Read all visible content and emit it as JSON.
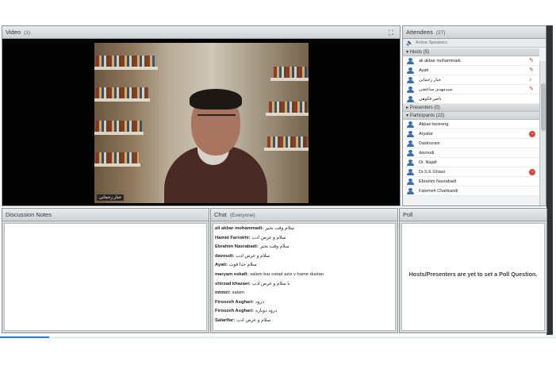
{
  "video_pod": {
    "title": "Video",
    "count": "(1)",
    "name_tag": "جبار رحمانی",
    "fullscreen_icon": "fullscreen-icon"
  },
  "attendees_pod": {
    "title": "Attendees",
    "count": "(27)",
    "active_speakers": "Active Speakers",
    "sections": {
      "hosts": "Hosts (5)",
      "presenters": "Presenters (0)",
      "participants": "Participants (22)"
    },
    "hosts": [
      {
        "name": "ali akbar mohammadi",
        "status": "pencil"
      },
      {
        "name": "Ayati",
        "status": "pencil"
      },
      {
        "name": "جبار رحمانی",
        "status": "mic"
      },
      {
        "name": "سیدمهدی ساعتچی",
        "status": "pencil"
      },
      {
        "name": "ناصر فکوهی",
        "status": ""
      }
    ],
    "participants": [
      {
        "name": "Akbari booreng",
        "status": ""
      },
      {
        "name": "Aryafar",
        "status": "raised"
      },
      {
        "name": "Dastourani",
        "status": ""
      },
      {
        "name": "davoudi",
        "status": ""
      },
      {
        "name": "Dr. Najafi",
        "status": ""
      },
      {
        "name": "Dr.S.E.Ghiasi",
        "status": "raised"
      },
      {
        "name": "Ebrahim Nasrabadi",
        "status": ""
      },
      {
        "name": "Fatemeh Chahkandi",
        "status": ""
      }
    ]
  },
  "notes_pod": {
    "title": "Discussion Notes"
  },
  "chat_pod": {
    "title": "Chat",
    "scope": "(Everyone)",
    "messages": [
      {
        "who": "ali akbar mohammadi:",
        "msg": "سلام وقت بخیر"
      },
      {
        "who": "Hamid Farrokhi:",
        "msg": "سلام و عرض ادب"
      },
      {
        "who": "Ebrahim Nasrabadi:",
        "msg": "سلام وقت بخیر"
      },
      {
        "who": "davoudi:",
        "msg": "سلام و عرض ادب"
      },
      {
        "who": "Ayati:",
        "msg": "سلام خدا قوت"
      },
      {
        "who": "maryam eskafi:",
        "msg": "salam bar ostad aziz v hame dustan"
      },
      {
        "who": "shirzad khazaei:",
        "msg": "با سلام و عرض ادب"
      },
      {
        "who": "mtmiri:",
        "msg": "salam"
      },
      {
        "who": "Firoozeh Asghari:",
        "msg": "درود"
      },
      {
        "who": "Firoozeh Asghari:",
        "msg": "درود دوباره"
      },
      {
        "who": "Salarifar:",
        "msg": "سلام و عرض ادب"
      }
    ]
  },
  "poll_pod": {
    "title": "Poll",
    "message": "Hosts/Presenters are yet to set a Poll Question."
  }
}
